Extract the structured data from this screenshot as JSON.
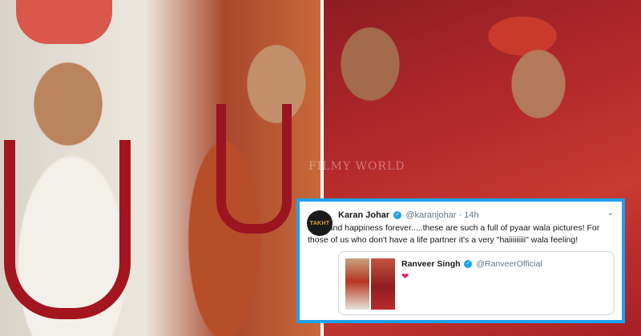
{
  "watermark": "FILMY WORLD",
  "tweet": {
    "avatar_text": "TAKHT",
    "author_name": "Karan Johar",
    "author_handle": "@karanjohar",
    "time": "· 14h",
    "text": "Love and happiness forever.....these are such a full of pyaar wala pictures! For those of us who don't have a life partner it's a very \"haiiiiiiiii\" wala feeling!",
    "quoted": {
      "author_name": "Ranveer Singh",
      "author_handle": "@RanveerOfficial",
      "heart": "❤"
    }
  },
  "colors": {
    "twitter_blue": "#1da1f2",
    "heart_red": "#e0245e"
  },
  "icons": [
    "verified-badge-icon",
    "chevron-down-icon",
    "heart-icon"
  ]
}
